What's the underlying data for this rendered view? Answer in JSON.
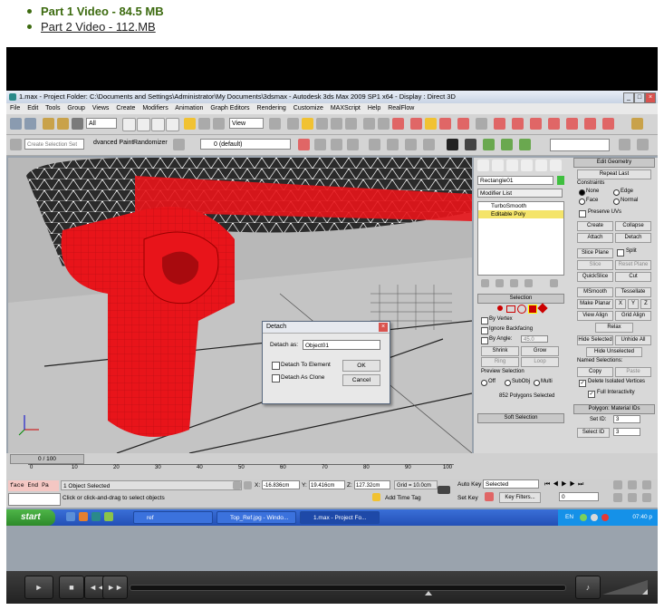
{
  "links": [
    {
      "label": "Part 1 Video - 84.5 MB"
    },
    {
      "label": "Part 2 Video - 112.MB"
    }
  ],
  "window": {
    "title": "1.max    - Project Folder: C:\\Documents and Settings\\Administrator\\My Documents\\3dsmax    - Autodesk 3ds Max  2009 SP1  x64      - Display : Direct 3D",
    "min": "_",
    "max": "□",
    "close": "×"
  },
  "menu": [
    "File",
    "Edit",
    "Tools",
    "Group",
    "Views",
    "Create",
    "Modifiers",
    "Animation",
    "Graph Editors",
    "Rendering",
    "Customize",
    "MAXScript",
    "Help",
    "RealFlow"
  ],
  "toolbar": {
    "selection_filter": "All",
    "ref_coord": "View",
    "selection_set": "Create Selection Set",
    "ribbon_tab1": "dvanced Paint",
    "ribbon_tab2": "Randomizer",
    "layer": "0 (default)"
  },
  "cmd": {
    "object_name": "Rectangle01",
    "modifier_list": "Modifier List",
    "stack": [
      "TurboSmooth",
      "Editable Poly"
    ],
    "selection_hdr": "Selection",
    "by_vertex": "By Vertex",
    "ignore_backfacing": "Ignore Backfacing",
    "by_angle": "By Angle:",
    "angle_val": "45.0",
    "shrink": "Shrink",
    "grow": "Grow",
    "ring": "Ring",
    "loop": "Loop",
    "preview_sel": "Preview Selection",
    "off": "Off",
    "subobj": "SubObj",
    "multi": "Multi",
    "sel_status": "852 Polygons Selected",
    "soft_sel": "Soft Selection"
  },
  "edit_geom": {
    "hdr": "Edit Geometry",
    "repeat_last": "Repeat Last",
    "constraints": "Constraints",
    "none": "None",
    "edge": "Edge",
    "face": "Face",
    "normal": "Normal",
    "preserve_uvs": "Preserve UVs",
    "create": "Create",
    "collapse": "Collapse",
    "attach": "Attach",
    "detach": "Detach",
    "slice_plane": "Slice Plane",
    "split": "Split",
    "slice": "Slice",
    "reset_plane": "Reset Plane",
    "quickslice": "QuickSlice",
    "cut": "Cut",
    "msmooth": "MSmooth",
    "tessellate": "Tessellate",
    "make_planar": "Make Planar",
    "x": "X",
    "y": "Y",
    "z": "Z",
    "view_align": "View Align",
    "grid_align": "Grid Align",
    "relax": "Relax",
    "hide_selected": "Hide Selected",
    "unhide_all": "Unhide All",
    "hide_unselected": "Hide Unselected",
    "named_sel": "Named Selections:",
    "copy": "Copy",
    "paste": "Paste",
    "delete_isolated": "Delete Isolated Vertices",
    "full_interactivity": "Full Interactivity",
    "mat_ids_hdr": "Polygon: Material IDs",
    "set_id": "Set ID:",
    "set_id_val": "3",
    "select_id": "Select ID",
    "select_id_val": "3"
  },
  "dialog": {
    "title": "Detach",
    "detach_as_label": "Detach as:",
    "detach_as_value": "Object01",
    "to_element": "Detach To Element",
    "as_clone": "Detach As Clone",
    "ok": "OK",
    "cancel": "Cancel"
  },
  "timeline": {
    "frame_counter": "0 / 100",
    "ticks": [
      "0",
      "10",
      "20",
      "30",
      "40",
      "50",
      "60",
      "70",
      "80",
      "90",
      "100"
    ]
  },
  "status": {
    "script_box": "face End Pa",
    "objects_selected": "1 Object Selected",
    "prompt": "Click or click-and-drag to select objects",
    "x_label": "X:",
    "x_val": "-16.836cm",
    "y_label": "Y:",
    "y_val": "19.416cm",
    "z_label": "Z:",
    "z_val": "127.32cm",
    "grid": "Grid = 10.0cm",
    "add_time_tag": "Add Time Tag",
    "auto_key": "Auto Key",
    "auto_key_sel": "Selected",
    "set_key": "Set Key",
    "key_filters": "Key Filters...",
    "frame": "0"
  },
  "taskbar": {
    "start": "start",
    "tasks": [
      "ref",
      "Top_Ref.jpg - Windo...",
      "1.max    - Project Fo..."
    ],
    "lang": "EN",
    "clock": "07:40 p"
  },
  "player": {
    "play": "►",
    "stop": "■",
    "prev": "◄◄",
    "next": "►►",
    "volume": "♪"
  },
  "colors": {
    "link_green": "#3d6b10",
    "object_red": "#e8141a",
    "taskbar_blue": "#2a5fcf"
  }
}
